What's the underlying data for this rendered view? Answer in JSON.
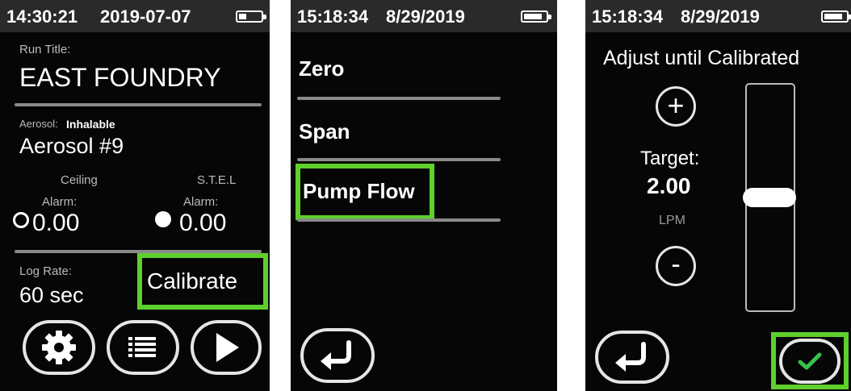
{
  "screen1": {
    "time": "14:30:21",
    "date": "2019-07-07",
    "run_title_label": "Run Title:",
    "run_title": "EAST FOUNDRY",
    "aerosol_label": "Aerosol:",
    "aerosol_type": "Inhalable",
    "aerosol_name": "Aerosol #9",
    "ceiling_label": "Ceiling",
    "ceiling_alarm_label": "Alarm:",
    "ceiling_value": "0.00",
    "stel_label": "S.T.E.L",
    "stel_alarm_label": "Alarm:",
    "stel_value": "0.00",
    "log_rate_label": "Log Rate:",
    "log_rate_value": "60 sec",
    "calibrate_label": "Calibrate",
    "icons": [
      "gear-icon",
      "list-icon",
      "play-icon"
    ]
  },
  "screen2": {
    "time": "15:18:34",
    "date": "8/29/2019",
    "menu": [
      "Zero",
      "Span",
      "Pump Flow"
    ],
    "icons": [
      "back-arrow-icon"
    ]
  },
  "screen3": {
    "time": "15:18:34",
    "date": "8/29/2019",
    "instruction": "Adjust until Calibrated",
    "increase_label": "+",
    "decrease_label": "-",
    "target_label": "Target:",
    "target_value": "2.00",
    "unit": "LPM",
    "slider_level": 0.5,
    "icons": [
      "back-arrow-icon",
      "check-icon"
    ]
  },
  "colors": {
    "highlight": "#5ed02b",
    "screen_bg": "#060606",
    "status_bar": "#2a2a2a",
    "check": "#35c24a"
  }
}
